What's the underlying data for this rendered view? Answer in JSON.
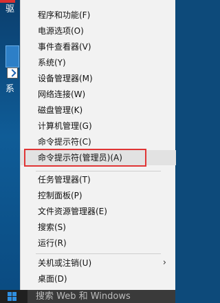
{
  "desktop": {
    "top_label": "驱",
    "mid_label": "系"
  },
  "menu": {
    "items": [
      {
        "label": "程序和功能(F)"
      },
      {
        "label": "电源选项(O)"
      },
      {
        "label": "事件查看器(V)"
      },
      {
        "label": "系统(Y)"
      },
      {
        "label": "设备管理器(M)"
      },
      {
        "label": "网络连接(W)"
      },
      {
        "label": "磁盘管理(K)"
      },
      {
        "label": "计算机管理(G)"
      },
      {
        "label": "命令提示符(C)"
      },
      {
        "label": "命令提示符(管理员)(A)"
      },
      {
        "label": "任务管理器(T)"
      },
      {
        "label": "控制面板(P)"
      },
      {
        "label": "文件资源管理器(E)"
      },
      {
        "label": "搜索(S)"
      },
      {
        "label": "运行(R)"
      },
      {
        "label": "关机或注销(U)"
      },
      {
        "label": "桌面(D)"
      }
    ],
    "submenu_arrow": "›"
  },
  "taskbar": {
    "search_placeholder": "搜索 Web 和 Windows"
  },
  "colors": {
    "highlight_border": "#e03434",
    "menu_bg": "#f2f2f2",
    "win_logo": "#2f8fe0"
  }
}
